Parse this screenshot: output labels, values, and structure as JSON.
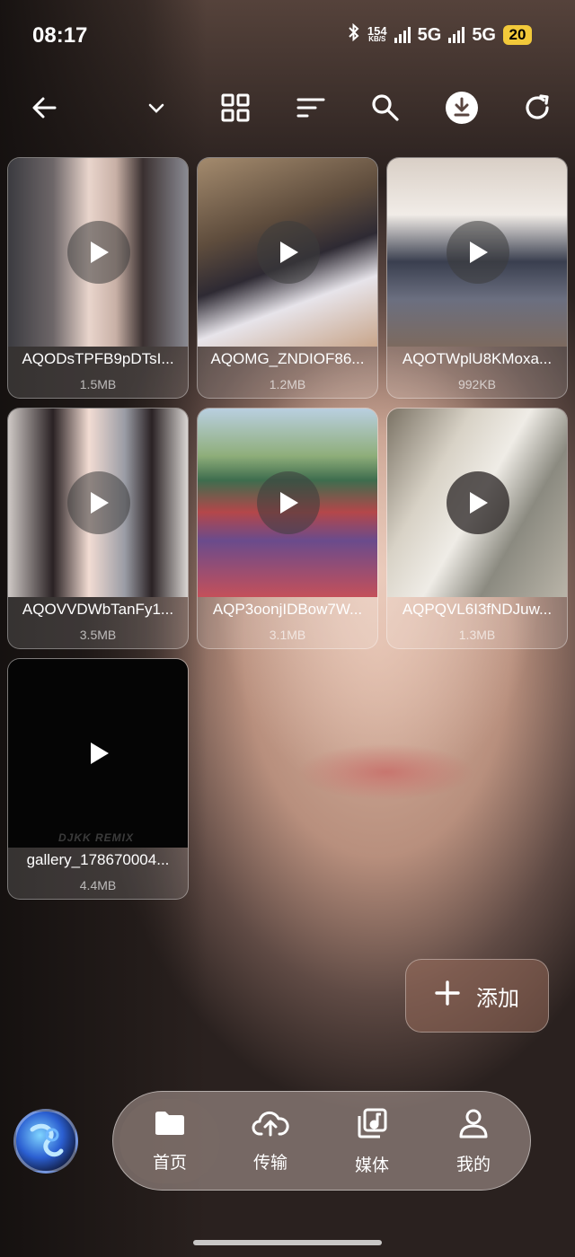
{
  "status_bar": {
    "time": "08:17",
    "net_speed": "154",
    "net_unit": "KB/S",
    "network_1": "5G",
    "network_2": "5G",
    "battery": "20"
  },
  "toolbar": {
    "icons": [
      "back-arrow-icon",
      "chevron-down-icon",
      "grid-view-icon",
      "sort-icon",
      "search-icon",
      "download-icon",
      "refresh-icon"
    ]
  },
  "files": [
    {
      "name": "AQODsTPFB9pDTsI...",
      "size": "1.5MB"
    },
    {
      "name": "AQOMG_ZNDIOF86...",
      "size": "1.2MB"
    },
    {
      "name": "AQOTWplU8KMoxa...",
      "size": "992KB"
    },
    {
      "name": "AQOVVDWbTanFy1...",
      "size": "3.5MB"
    },
    {
      "name": "AQP3oonjIDBow7W...",
      "size": "3.1MB"
    },
    {
      "name": "AQPQVL6I3fNDJuw...",
      "size": "1.3MB"
    },
    {
      "name": "gallery_17867000​4...",
      "size": "4.4MB",
      "watermark": "DJKK REMIX"
    }
  ],
  "add_button": {
    "label": "添加"
  },
  "nav": {
    "items": [
      {
        "label": "首页",
        "icon": "folder-icon",
        "active": true
      },
      {
        "label": "传输",
        "icon": "cloud-upload-icon",
        "active": false
      },
      {
        "label": "媒体",
        "icon": "media-library-icon",
        "active": false
      },
      {
        "label": "我的",
        "icon": "person-icon",
        "active": false
      }
    ]
  }
}
